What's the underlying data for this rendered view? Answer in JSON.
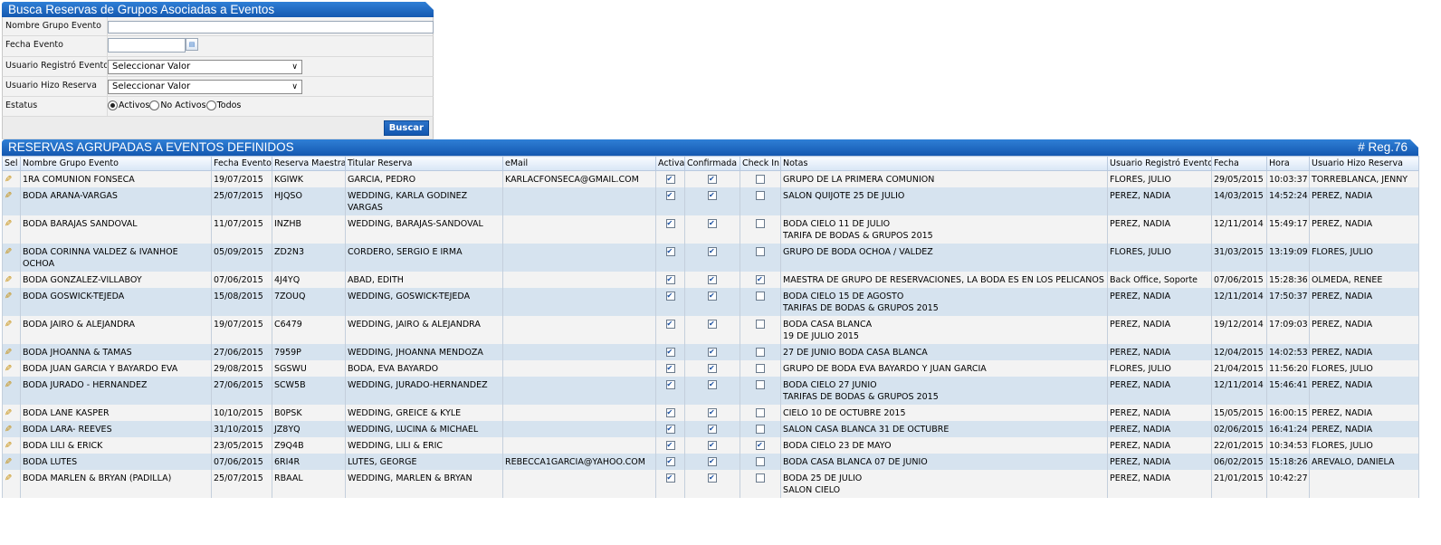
{
  "search": {
    "title": "Busca Reservas de Grupos Asociadas a Eventos",
    "fields": {
      "nombre_label": "Nombre Grupo Evento",
      "nombre_value": "",
      "fecha_label": "Fecha Evento",
      "fecha_value": "",
      "usuario_registro_label": "Usuario Registró Evento",
      "usuario_registro_value": "Seleccionar Valor",
      "usuario_reserva_label": "Usuario Hizo Reserva",
      "usuario_reserva_value": "Seleccionar Valor",
      "estatus_label": "Estatus",
      "estatus_options": [
        "Activos",
        "No Activos",
        "Todos"
      ],
      "estatus_selected": "Activos"
    },
    "button": "Buscar"
  },
  "results": {
    "title": "RESERVAS AGRUPADAS A EVENTOS DEFINIDOS",
    "count": "# Reg.76",
    "columns": [
      "Sel",
      "Nombre Grupo Evento",
      "Fecha Evento",
      "Reserva Maestra",
      "Titular Reserva",
      "eMail",
      "Activa",
      "Confirmada",
      "Check In",
      "Notas",
      "Usuario Registró Evento",
      "Fecha",
      "Hora",
      "Usuario Hizo Reserva"
    ],
    "rows": [
      {
        "nombre": "1RA COMUNION FONSECA",
        "fecha_evento": "19/07/2015",
        "reserva": "KGIWK",
        "titular": "GARCIA, PEDRO",
        "email": "KARLACFONSECA@GMAIL.COM",
        "activa": true,
        "confirmada": true,
        "checkin": false,
        "notas": "GRUPO DE LA PRIMERA COMUNION",
        "usuario_reg": "FLORES, JULIO",
        "fecha": "29/05/2015",
        "hora": "10:03:37",
        "usuario_res": "TORREBLANCA, JENNY"
      },
      {
        "nombre": "BODA ARANA-VARGAS",
        "fecha_evento": "25/07/2015",
        "reserva": "HJQSO",
        "titular": "WEDDING, KARLA GODINEZ VARGAS",
        "email": "",
        "activa": true,
        "confirmada": true,
        "checkin": false,
        "notas": "SALON QUIJOTE 25 DE JULIO",
        "usuario_reg": "PEREZ, NADIA",
        "fecha": "14/03/2015",
        "hora": "14:52:24",
        "usuario_res": "PEREZ, NADIA"
      },
      {
        "nombre": "BODA BARAJAS SANDOVAL",
        "fecha_evento": "11/07/2015",
        "reserva": "INZHB",
        "titular": "WEDDING, BARAJAS-SANDOVAL",
        "email": "",
        "activa": true,
        "confirmada": true,
        "checkin": false,
        "notas": "BODA CIELO 11 DE JULIO\nTARIFA DE BODAS & GRUPOS 2015",
        "usuario_reg": "PEREZ, NADIA",
        "fecha": "12/11/2014",
        "hora": "15:49:17",
        "usuario_res": "PEREZ, NADIA"
      },
      {
        "nombre": "BODA CORINNA VALDEZ & IVANHOE OCHOA",
        "fecha_evento": "05/09/2015",
        "reserva": "ZD2N3",
        "titular": "CORDERO, SERGIO E IRMA",
        "email": "",
        "activa": true,
        "confirmada": true,
        "checkin": false,
        "notas": "GRUPO DE BODA OCHOA / VALDEZ",
        "usuario_reg": "FLORES, JULIO",
        "fecha": "31/03/2015",
        "hora": "13:19:09",
        "usuario_res": "FLORES, JULIO"
      },
      {
        "nombre": "BODA GONZALEZ-VILLABOY",
        "fecha_evento": "07/06/2015",
        "reserva": "4J4YQ",
        "titular": "ABAD, EDITH",
        "email": "",
        "activa": true,
        "confirmada": true,
        "checkin": true,
        "notas": "MAESTRA DE GRUPO DE RESERVACIONES, LA BODA ES EN LOS PELICANOS",
        "usuario_reg": "Back Office, Soporte",
        "fecha": "07/06/2015",
        "hora": "15:28:36",
        "usuario_res": "OLMEDA, RENEE"
      },
      {
        "nombre": "BODA GOSWICK-TEJEDA",
        "fecha_evento": "15/08/2015",
        "reserva": "7ZOUQ",
        "titular": "WEDDING, GOSWICK-TEJEDA",
        "email": "",
        "activa": true,
        "confirmada": true,
        "checkin": false,
        "notas": "BODA CIELO 15 DE AGOSTO\nTARIFAS DE BODAS & GRUPOS 2015",
        "usuario_reg": "PEREZ, NADIA",
        "fecha": "12/11/2014",
        "hora": "17:50:37",
        "usuario_res": "PEREZ, NADIA"
      },
      {
        "nombre": "BODA JAIRO & ALEJANDRA",
        "fecha_evento": "19/07/2015",
        "reserva": "C6479",
        "titular": "WEDDING, JAIRO & ALEJANDRA",
        "email": "",
        "activa": true,
        "confirmada": true,
        "checkin": false,
        "notas": "BODA CASA BLANCA\n19 DE JULIO 2015",
        "usuario_reg": "PEREZ, NADIA",
        "fecha": "19/12/2014",
        "hora": "17:09:03",
        "usuario_res": "PEREZ, NADIA"
      },
      {
        "nombre": "BODA JHOANNA & TAMAS",
        "fecha_evento": "27/06/2015",
        "reserva": "7959P",
        "titular": "WEDDING, JHOANNA MENDOZA",
        "email": "",
        "activa": true,
        "confirmada": true,
        "checkin": false,
        "notas": "27 DE JUNIO BODA CASA BLANCA",
        "usuario_reg": "PEREZ, NADIA",
        "fecha": "12/04/2015",
        "hora": "14:02:53",
        "usuario_res": "PEREZ, NADIA"
      },
      {
        "nombre": "BODA JUAN GARCIA Y BAYARDO EVA",
        "fecha_evento": "29/08/2015",
        "reserva": "SGSWU",
        "titular": "BODA, EVA BAYARDO",
        "email": "",
        "activa": true,
        "confirmada": true,
        "checkin": false,
        "notas": "GRUPO DE BODA EVA BAYARDO Y JUAN GARCIA",
        "usuario_reg": "FLORES, JULIO",
        "fecha": "21/04/2015",
        "hora": "11:56:20",
        "usuario_res": "FLORES, JULIO"
      },
      {
        "nombre": "BODA JURADO - HERNANDEZ",
        "fecha_evento": "27/06/2015",
        "reserva": "SCW5B",
        "titular": "WEDDING, JURADO-HERNANDEZ",
        "email": "",
        "activa": true,
        "confirmada": true,
        "checkin": false,
        "notas": "BODA CIELO 27 JUNIO\nTARIFAS DE BODAS & GRUPOS 2015",
        "usuario_reg": "PEREZ, NADIA",
        "fecha": "12/11/2014",
        "hora": "15:46:41",
        "usuario_res": "PEREZ, NADIA"
      },
      {
        "nombre": "BODA LANE KASPER",
        "fecha_evento": "10/10/2015",
        "reserva": "B0PSK",
        "titular": "WEDDING, GREICE & KYLE",
        "email": "",
        "activa": true,
        "confirmada": true,
        "checkin": false,
        "notas": "CIELO 10 DE OCTUBRE 2015",
        "usuario_reg": "PEREZ, NADIA",
        "fecha": "15/05/2015",
        "hora": "16:00:15",
        "usuario_res": "PEREZ, NADIA"
      },
      {
        "nombre": "BODA LARA- REEVES",
        "fecha_evento": "31/10/2015",
        "reserva": "JZ8YQ",
        "titular": "WEDDING, LUCINA & MICHAEL",
        "email": "",
        "activa": true,
        "confirmada": true,
        "checkin": false,
        "notas": "SALON CASA BLANCA 31 DE OCTUBRE",
        "usuario_reg": "PEREZ, NADIA",
        "fecha": "02/06/2015",
        "hora": "16:41:24",
        "usuario_res": "PEREZ, NADIA"
      },
      {
        "nombre": "BODA LILI & ERICK",
        "fecha_evento": "23/05/2015",
        "reserva": "Z9Q4B",
        "titular": "WEDDING, LILI & ERIC",
        "email": "",
        "activa": true,
        "confirmada": true,
        "checkin": true,
        "notas": "BODA CIELO 23 DE MAYO",
        "usuario_reg": "PEREZ, NADIA",
        "fecha": "22/01/2015",
        "hora": "10:34:53",
        "usuario_res": "FLORES, JULIO"
      },
      {
        "nombre": "BODA LUTES",
        "fecha_evento": "07/06/2015",
        "reserva": "6RI4R",
        "titular": "LUTES, GEORGE",
        "email": "REBECCA1GARCIA@YAHOO.COM",
        "activa": true,
        "confirmada": true,
        "checkin": false,
        "notas": "BODA CASA BLANCA 07 DE JUNIO",
        "usuario_reg": "PEREZ, NADIA",
        "fecha": "06/02/2015",
        "hora": "15:18:26",
        "usuario_res": "AREVALO, DANIELA"
      },
      {
        "nombre": "BODA MARLEN & BRYAN (PADILLA)",
        "fecha_evento": "25/07/2015",
        "reserva": "RBAAL",
        "titular": "WEDDING, MARLEN & BRYAN",
        "email": "",
        "activa": true,
        "confirmada": true,
        "checkin": false,
        "notas": "BODA 25 DE JULIO\nSALON CIELO",
        "usuario_reg": "PEREZ, NADIA",
        "fecha": "21/01/2015",
        "hora": "10:42:27",
        "usuario_res": ""
      }
    ]
  },
  "colors": {
    "header_blue": "#1f6cc7",
    "row_alt": "#d6e3ef",
    "row": "#f3f3f3"
  },
  "icons": {
    "edit": "pencil-icon",
    "calendar": "calendar-icon"
  }
}
